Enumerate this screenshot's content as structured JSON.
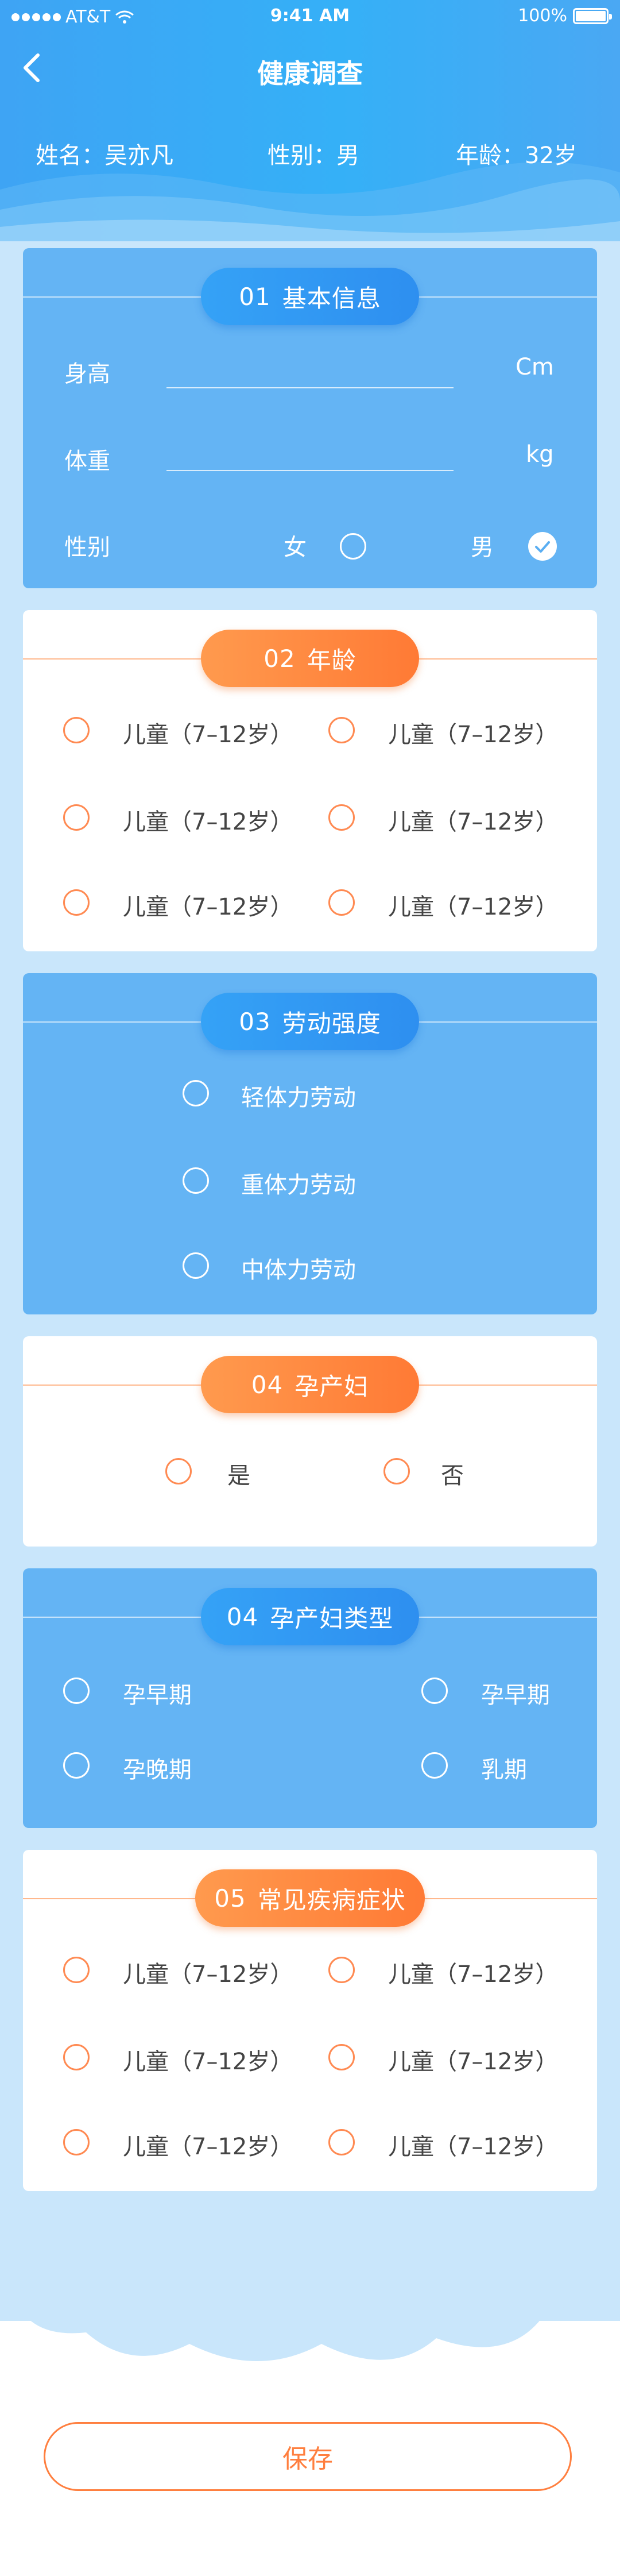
{
  "status_bar": {
    "carrier": "AT&T",
    "time": "9:41 AM",
    "battery": "100%"
  },
  "header": {
    "title": "健康调查",
    "name": "姓名：吴亦凡",
    "gender": "性别：男",
    "age": "年龄：32岁"
  },
  "section1": {
    "number": "01",
    "title": "基本信息",
    "height_label": "身高",
    "height_value": "",
    "height_unit": "Cm",
    "weight_label": "体重",
    "weight_value": "",
    "weight_unit": "kg",
    "gender_label": "性别",
    "female": "女",
    "male": "男",
    "selected": "男"
  },
  "section2": {
    "number": "02",
    "title": "年龄",
    "options": [
      "儿童（7–12岁）",
      "儿童（7–12岁）",
      "儿童（7–12岁）",
      "儿童（7–12岁）",
      "儿童（7–12岁）",
      "儿童（7–12岁）"
    ]
  },
  "section3": {
    "number": "03",
    "title": "劳动强度",
    "options": [
      "轻体力劳动",
      "重体力劳动",
      "中体力劳动"
    ]
  },
  "section4": {
    "number": "04",
    "title": "孕产妇",
    "options": [
      "是",
      "否"
    ]
  },
  "section5": {
    "number": "04",
    "title": "孕产妇类型",
    "options": [
      "孕早期",
      "孕早期",
      "孕晚期",
      "乳期"
    ]
  },
  "section6": {
    "number": "05",
    "title": "常见疾病症状",
    "options": [
      "儿童（7–12岁）",
      "儿童（7–12岁）",
      "儿童（7–12岁）",
      "儿童（7–12岁）",
      "儿童（7–12岁）",
      "儿童（7–12岁）"
    ]
  },
  "save_button": "保存",
  "colors": {
    "primary_blue": "#3ea4f4",
    "card_blue": "#64b4f4",
    "accent_orange": "#ff7f3f",
    "light_bg": "#c9e6fb"
  }
}
